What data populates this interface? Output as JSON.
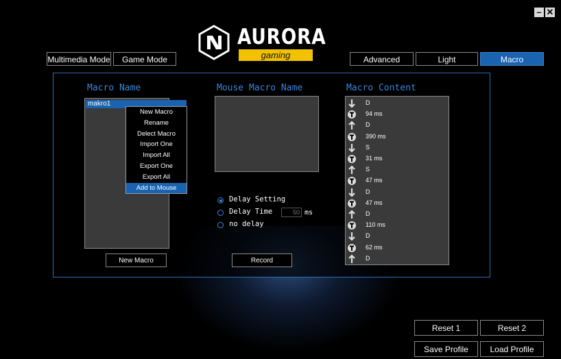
{
  "window": {
    "minimize_label": "–",
    "close_label": "✕"
  },
  "logo": {
    "brand": "AURORA",
    "sub": "gaming"
  },
  "mode_tabs": [
    {
      "label": "Multimedia Mode"
    },
    {
      "label": "Game Mode"
    }
  ],
  "section_tabs": [
    {
      "label": "Advanced"
    },
    {
      "label": "Light"
    },
    {
      "label": "Macro",
      "active": true
    }
  ],
  "macro_name": {
    "heading": "Macro Name",
    "items": [
      "makro1"
    ],
    "context_menu": [
      "New Macro",
      "Rename",
      "Delect Macro",
      "Import One",
      "Import All",
      "Export One",
      "Export All",
      "Add to Mouse"
    ],
    "context_highlight": "Add to Mouse",
    "new_button": "New Macro"
  },
  "mouse_macro": {
    "heading": "Mouse Macro Name"
  },
  "delay": {
    "options": [
      {
        "label": "Delay Setting",
        "selected": true
      },
      {
        "label": "Delay Time",
        "selected": false
      },
      {
        "label": "no delay",
        "selected": false
      }
    ],
    "time_value": "50",
    "unit": "ms"
  },
  "record_button": "Record",
  "macro_content": {
    "heading": "Macro Content",
    "rows": [
      {
        "icon": "key-down-icon",
        "text": "D"
      },
      {
        "icon": "delay-timer-icon",
        "text": "94 ms"
      },
      {
        "icon": "key-up-icon",
        "text": "D"
      },
      {
        "icon": "delay-timer-icon",
        "text": "390 ms"
      },
      {
        "icon": "key-down-icon",
        "text": "S"
      },
      {
        "icon": "delay-timer-icon",
        "text": "31 ms"
      },
      {
        "icon": "key-up-icon",
        "text": "S"
      },
      {
        "icon": "delay-timer-icon",
        "text": "47 ms"
      },
      {
        "icon": "key-down-icon",
        "text": "D"
      },
      {
        "icon": "delay-timer-icon",
        "text": "47 ms"
      },
      {
        "icon": "key-up-icon",
        "text": "D"
      },
      {
        "icon": "delay-timer-icon",
        "text": "110 ms"
      },
      {
        "icon": "key-down-icon",
        "text": "D"
      },
      {
        "icon": "delay-timer-icon",
        "text": "62 ms"
      },
      {
        "icon": "key-up-icon",
        "text": "D"
      }
    ]
  },
  "footer": {
    "reset1": "Reset 1",
    "reset2": "Reset 2",
    "save": "Save Profile",
    "load": "Load Profile"
  },
  "colors": {
    "accent": "#1a63b0",
    "heading": "#3b86d8",
    "logo_yellow": "#f2c200"
  }
}
